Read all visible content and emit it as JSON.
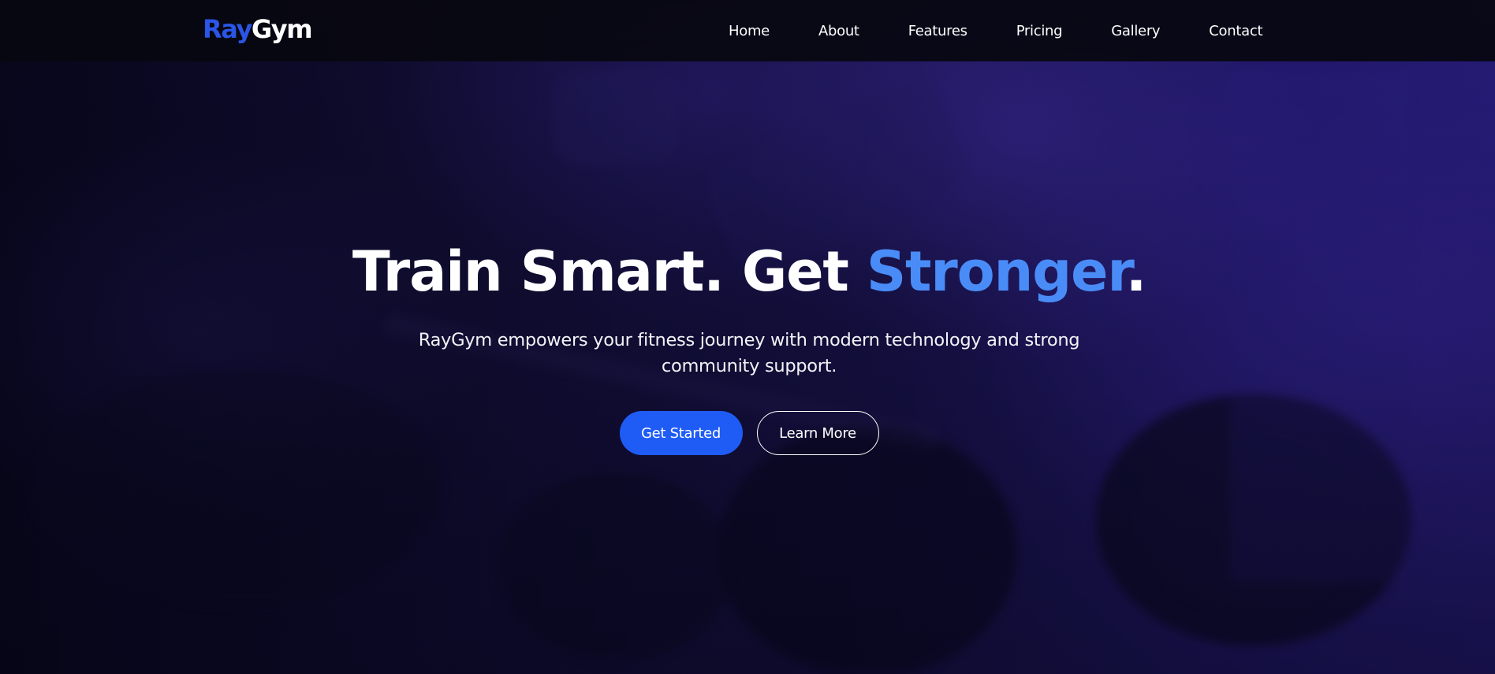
{
  "brand": {
    "logo_part1": "Ray",
    "logo_part2": "Gym"
  },
  "nav": {
    "items": [
      {
        "label": "Home"
      },
      {
        "label": "About"
      },
      {
        "label": "Features"
      },
      {
        "label": "Pricing"
      },
      {
        "label": "Gallery"
      },
      {
        "label": "Contact"
      }
    ]
  },
  "hero": {
    "title_main": "Train Smart. Get ",
    "title_accent": "Stronger",
    "title_end": ".",
    "subtitle": "RayGym empowers your fitness journey with modern technology and strong community support.",
    "primary_button": "Get Started",
    "secondary_button": "Learn More"
  },
  "colors": {
    "brand_blue": "#2a55e6",
    "accent_blue": "#4a8cf7",
    "button_blue": "#1f5cf6",
    "navbar_bg": "#08080f",
    "hero_tint": "#1a1450"
  }
}
